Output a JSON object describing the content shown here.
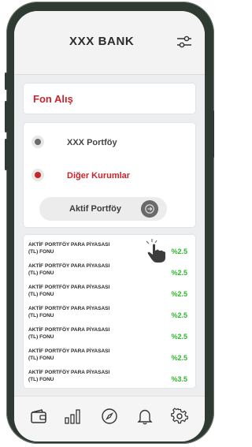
{
  "header": {
    "title": "XXX BANK",
    "filter_icon": "sliders-icon"
  },
  "fon": {
    "title": "Fon Alış"
  },
  "portfolio_options": {
    "items": [
      {
        "label": "XXX Portföy",
        "selected": false,
        "dot_color": "#6a6a6a"
      },
      {
        "label": "Diğer Kurumlar",
        "selected": true,
        "dot_color": "#c8252b"
      }
    ],
    "aktif_button": "Aktif Portföy"
  },
  "funds": [
    {
      "name_line1": "AKTİF PORTFÖY PARA PİYASASI",
      "name_line2": "(TL) FONU",
      "rate": "%2.5"
    },
    {
      "name_line1": "AKTİF PORTFÖY PARA PİYASASI",
      "name_line2": "(TL) FONU",
      "rate": "%2.5"
    },
    {
      "name_line1": "AKTİF PORTFÖY PARA PİYASASI",
      "name_line2": "(TL) FONU",
      "rate": "%2.5"
    },
    {
      "name_line1": "AKTİF PORTFÖY PARA PİYASASI",
      "name_line2": "(TL) FONU",
      "rate": "%2.5"
    },
    {
      "name_line1": "AKTİF PORTFÖY PARA PİYASASI",
      "name_line2": "(TL) FONU",
      "rate": "%2.5"
    },
    {
      "name_line1": "AKTİF PORTFÖY PARA PİYASASI",
      "name_line2": "(TL) FONU",
      "rate": "%2.5"
    },
    {
      "name_line1": "AKTİF PORTFÖY PARA PİYASASI",
      "name_line2": "(TL) FONU",
      "rate": "%3.5"
    }
  ],
  "tabbar": {
    "items": [
      "wallet-icon",
      "bar-chart-icon",
      "compass-icon",
      "bell-icon",
      "gear-icon"
    ]
  },
  "colors": {
    "accent_red": "#c8252b",
    "rate_green": "#2fb52f"
  }
}
